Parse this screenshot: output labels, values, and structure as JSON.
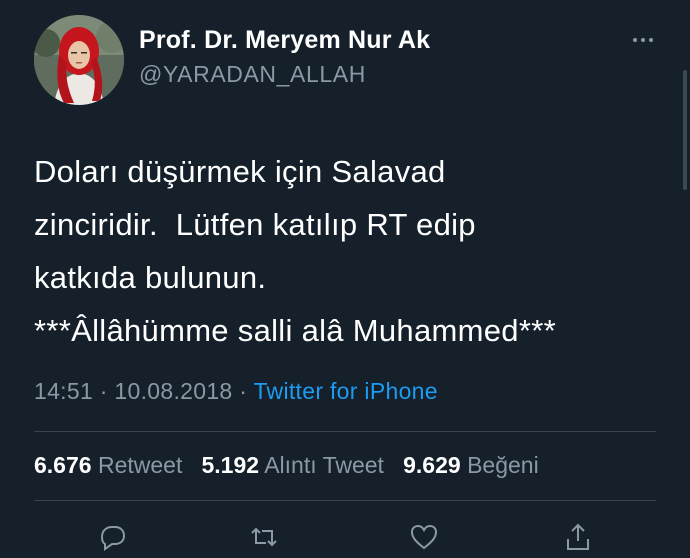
{
  "author": {
    "display_name": "Prof. Dr. Meryem Nur Ak",
    "handle": "@YARADAN_ALLAH",
    "avatar_icon": "profile-photo"
  },
  "tweet": {
    "lines": [
      "Doları düşürmek için Salavad",
      "zinciridir.  Lütfen katılıp RT edip",
      "katkıda bulunun.",
      "***Âllâhümme salli alâ Muhammed***"
    ]
  },
  "meta": {
    "time": "14:51",
    "separator": " · ",
    "date": "10.08.2018",
    "source": "Twitter for iPhone"
  },
  "stats": {
    "retweets_count": "6.676",
    "retweets_label": "Retweet",
    "quotes_count": "5.192",
    "quotes_label": "Alıntı Tweet",
    "likes_count": "9.629",
    "likes_label": "Beğeni"
  },
  "actions": [
    "reply-icon",
    "retweet-icon",
    "like-icon",
    "share-icon"
  ],
  "colors": {
    "background": "#15202b",
    "primary_text": "#ffffff",
    "secondary_text": "#8b98a5",
    "link": "#1d9bf0",
    "divider": "#38444d"
  }
}
